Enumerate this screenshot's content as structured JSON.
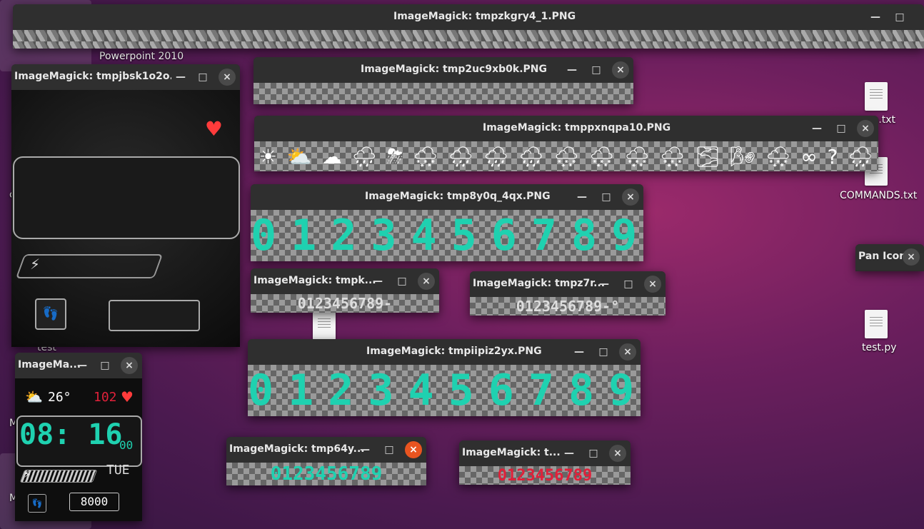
{
  "desktop": {
    "labels": {
      "powerpoint": "Powerpoint 2010",
      "txt1": "o.txt",
      "commands": "COMMANDS.txt",
      "test_folder": "test",
      "test_py": "test.py",
      "letter_c": "c",
      "letter_m1": "M",
      "letter_m2": "M"
    }
  },
  "windows": {
    "w1": {
      "title": "ImageMagick: tmpzkgry4_1.PNG"
    },
    "w2": {
      "title": "ImageMagick: tmpjbsk1o2o...."
    },
    "w3": {
      "title": "ImageMagick: tmp2uc9xb0k.PNG"
    },
    "w4": {
      "title": "ImageMagick: tmppxnqpa10.PNG"
    },
    "w5": {
      "title": "ImageMagick: tmp8y0q_4qx.PNG",
      "digits": "0123456789"
    },
    "w6": {
      "title": "ImageMagick: tmpk...",
      "digits": "0123456789-"
    },
    "w7": {
      "title": "ImageMagick: tmpz7r...",
      "digits": "0123456789-°"
    },
    "w8": {
      "title": "ImageMagick: tmpiipiz2yx.PNG",
      "digits": "0123456789"
    },
    "w9": {
      "title": "ImageMagick: tmp64y...",
      "digits": "0123456789"
    },
    "w10": {
      "title": "ImageMagick: t...",
      "digits": "0123456789"
    },
    "w11": {
      "title": "ImageMa...",
      "temp": "26°",
      "heart_rate": "102",
      "time": "08: 16",
      "seconds": "00",
      "day": "TUE",
      "steps": "8000"
    },
    "pan": {
      "title": "Pan Icon"
    }
  },
  "controls": {
    "minimize": "—",
    "maximize": "□",
    "close": "×"
  },
  "icons": [
    "☀",
    "⛅",
    "☁",
    "🌧",
    "⛈",
    "🌨",
    "🌧",
    "🌧",
    "🌧",
    "🌨",
    "🌨",
    "🌨",
    "🌨",
    "🌫",
    "🌬",
    "🌨",
    "∞",
    "?",
    "🌧"
  ],
  "colors": {
    "accent": "#e95420",
    "teal": "#1fd1b0",
    "red": "#e0213a"
  }
}
